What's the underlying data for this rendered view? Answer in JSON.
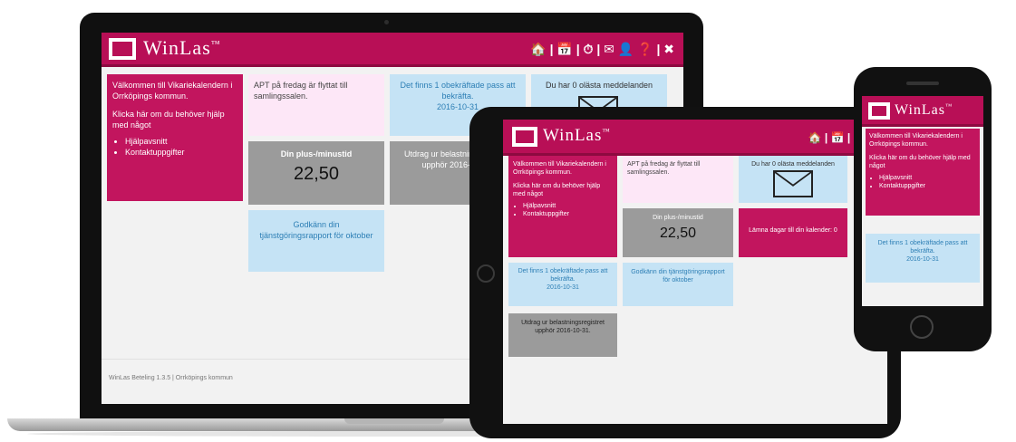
{
  "app": {
    "logo_text": "WinLas",
    "logo_tm": "™",
    "footer": "WinLas Beteling 1.3.5 | Orrköpings kommun"
  },
  "nav": {
    "home": "🏠",
    "calendar": "📅",
    "time": "⏱",
    "mail": "✉",
    "user": "👤",
    "help": "❓",
    "close": "✖",
    "sep": "|"
  },
  "laptop": {
    "welcome_title": "Välkommen till Vikariekalendern i Orrköpings kommun.",
    "welcome_help": "Klicka här om du behöver hjälp med något",
    "links": [
      "Hjälpavsnitt",
      "Kontaktuppgifter"
    ],
    "notice": "APT på fredag är flyttat till samlingssalen.",
    "unfilled": "Det finns 1 obekräftade pass att bekräfta.",
    "unfilled_date": "2016-10-31",
    "messages": "Du har 0 olästa meddelanden",
    "plus_label": "Din plus-/minustid",
    "plus_value": "22,50",
    "extract_label": "Utdrag ur belastningsregistret upphör 2016-10-31.",
    "report": "Godkänn din tjänstgöringsrapport för oktober"
  },
  "tablet": {
    "welcome_title": "Välkommen till Vikariekalendern i Orrköpings kommun.",
    "welcome_help": "Klicka här om du behöver hjälp med något",
    "links": [
      "Hjälpavsnitt",
      "Kontaktuppgifter"
    ],
    "notice": "APT på fredag är flyttat till samlingssalen.",
    "messages": "Du har 0 olästa meddelanden",
    "plus_label": "Din plus-/minustid",
    "plus_value": "22,50",
    "calendar_note": "Lämna dagar till din kalender: 0",
    "unfilled": "Det finns 1 obekräftade pass att bekräfta.",
    "unfilled_date": "2016-10-31",
    "report": "Godkänn din tjänstgöringsrapport för oktober",
    "extract_label": "Utdrag ur belastningsregistret upphör 2016-10-31."
  },
  "phone": {
    "welcome_title": "Välkommen till Vikariekalendern i Orrköpings kommun.",
    "welcome_help": "Klicka här om du behöver hjälp med något",
    "links": [
      "Hjälpavsnitt",
      "Kontaktuppgifter"
    ],
    "unfilled": "Det finns 1 obekräftade pass att bekräfta.",
    "unfilled_date": "2016-10-31"
  },
  "colors": {
    "brand": "#b80f56",
    "tile_pink": "#fde7f7",
    "tile_blue": "#c5e3f5",
    "tile_gray": "#9b9b9b"
  }
}
